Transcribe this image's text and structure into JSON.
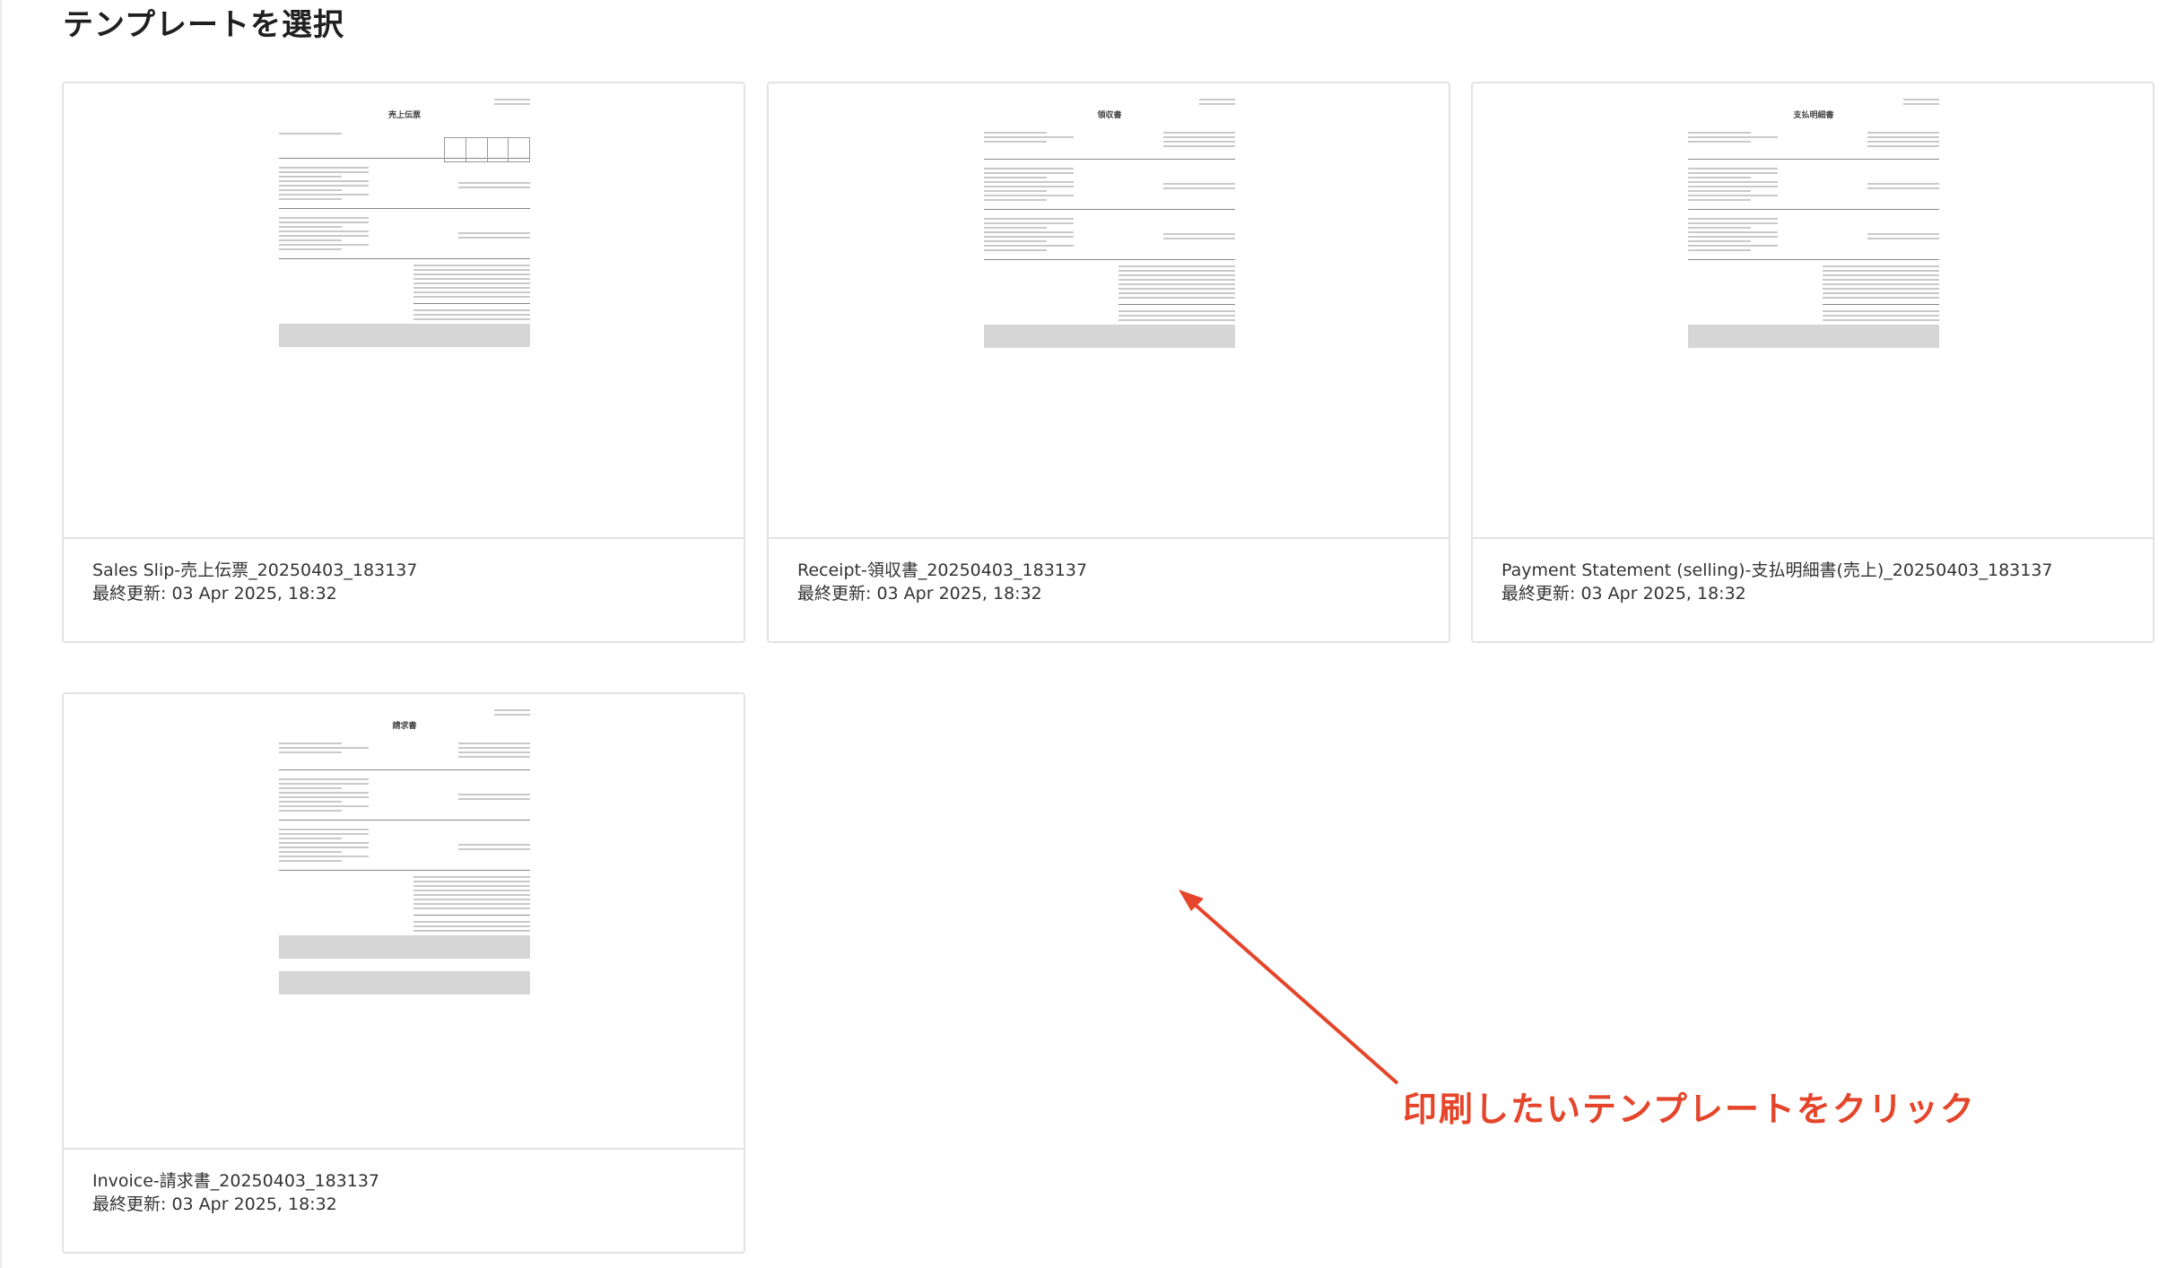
{
  "header": {
    "title": "テンプレートを選択"
  },
  "templates": [
    {
      "name": "Sales Slip-売上伝票_20250403_183137",
      "updated": "最終更新: 03 Apr 2025, 18:32",
      "doc_title": "売上伝票"
    },
    {
      "name": "Receipt-領収書_20250403_183137",
      "updated": "最終更新: 03 Apr 2025, 18:32",
      "doc_title": "領収書"
    },
    {
      "name": "Payment Statement (selling)-支払明細書(売上)_20250403_183137",
      "updated": "最終更新: 03 Apr 2025, 18:32",
      "doc_title": "支払明細書"
    },
    {
      "name": "Invoice-請求書_20250403_183137",
      "updated": "最終更新: 03 Apr 2025, 18:32",
      "doc_title": "請求書"
    }
  ],
  "annotation": {
    "text": "印刷したいテンプレートをクリック",
    "color": "#e5452a"
  }
}
